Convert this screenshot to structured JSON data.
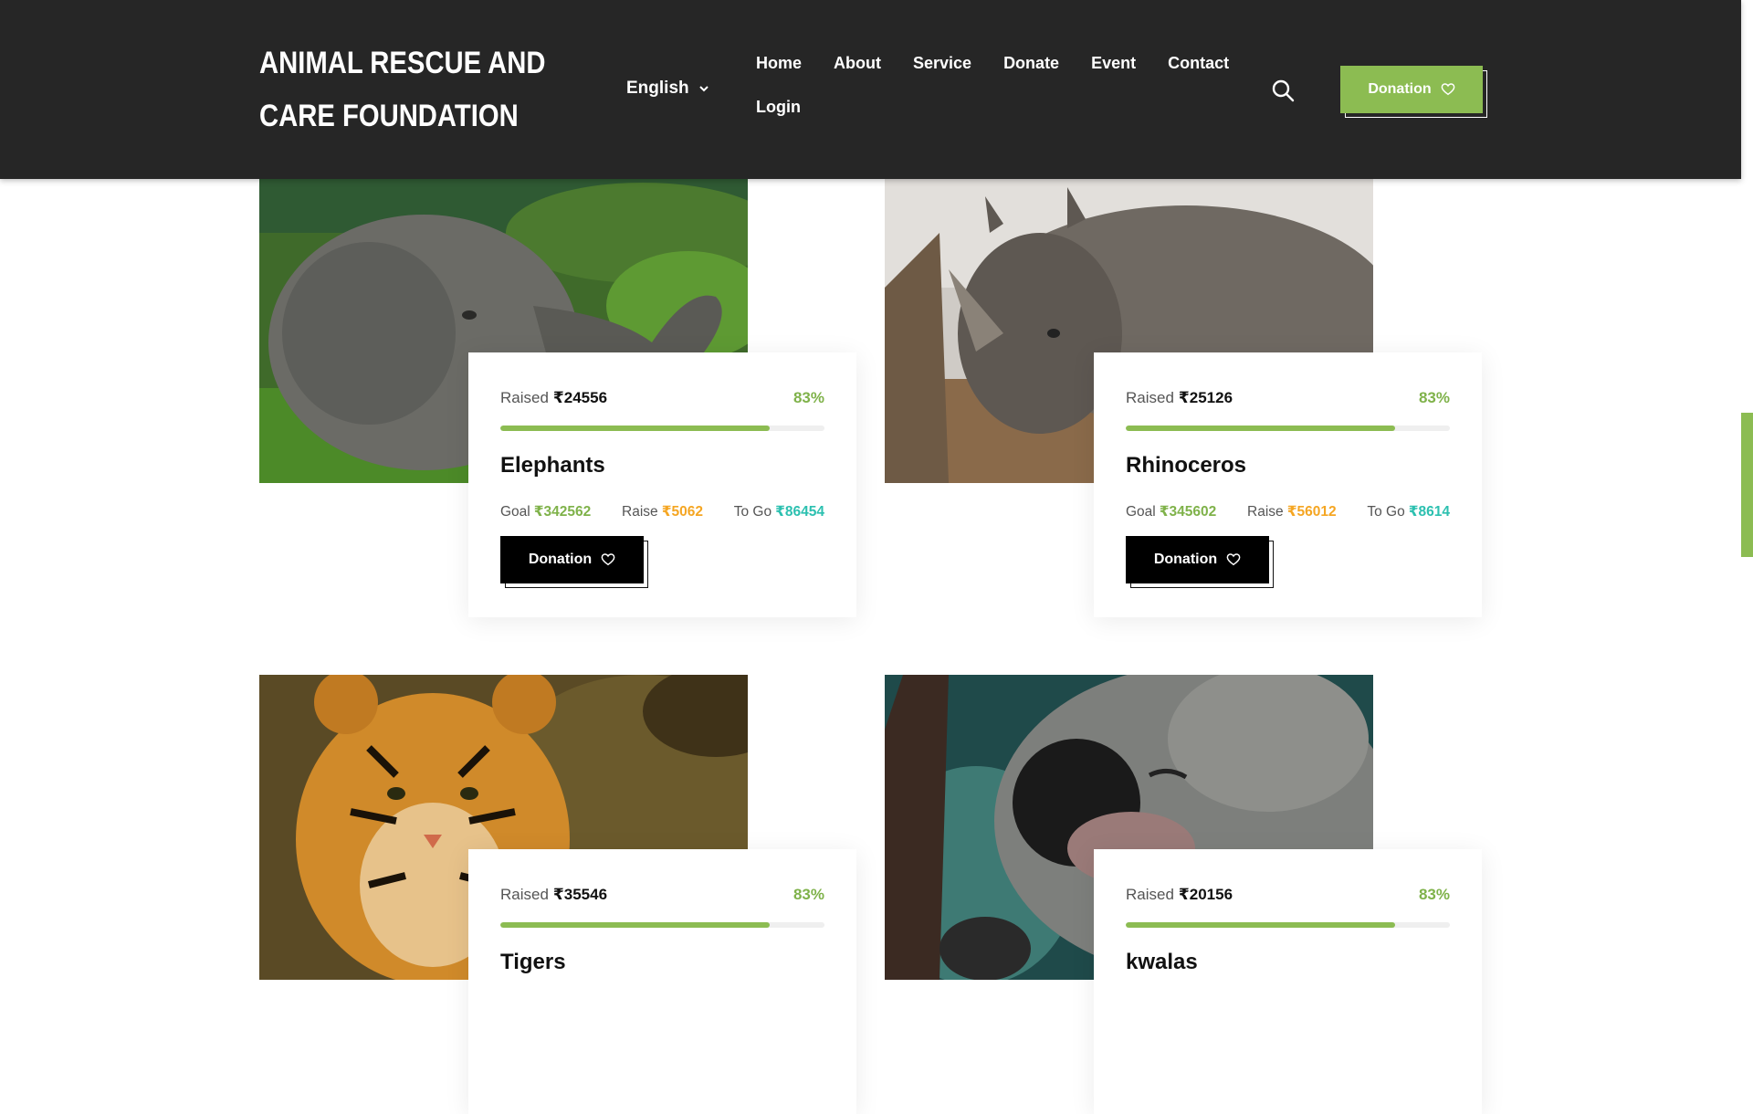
{
  "header": {
    "brand": "ANIMAL RESCUE AND CARE FOUNDATION",
    "language": "English",
    "nav": [
      "Home",
      "About",
      "Service",
      "Donate",
      "Event",
      "Contact",
      "Login"
    ],
    "donate_label": "Donation"
  },
  "colors": {
    "accent_green": "#8cbc52",
    "header_bg": "#262626",
    "raise_orange": "#f5a623",
    "togo_teal": "#2cc0b0"
  },
  "cards": [
    {
      "image_icon": "elephant-photo",
      "raised_label": "Raised",
      "raised": "₹24556",
      "percent": "83%",
      "progress": 0.83,
      "name": "Elephants",
      "goal_label": "Goal",
      "goal": "₹342562",
      "raise_label": "Raise",
      "raise": "₹5062",
      "togo_label": "To Go",
      "togo": "₹86454",
      "button": "Donation"
    },
    {
      "image_icon": "rhinoceros-photo",
      "raised_label": "Raised",
      "raised": "₹25126",
      "percent": "83%",
      "progress": 0.83,
      "name": "Rhinoceros",
      "goal_label": "Goal",
      "goal": "₹345602",
      "raise_label": "Raise",
      "raise": "₹56012",
      "togo_label": "To Go",
      "togo": "₹8614",
      "button": "Donation"
    },
    {
      "image_icon": "tiger-photo",
      "raised_label": "Raised",
      "raised": "₹35546",
      "percent": "83%",
      "progress": 0.83,
      "name": "Tigers"
    },
    {
      "image_icon": "koala-photo",
      "raised_label": "Raised",
      "raised": "₹20156",
      "percent": "83%",
      "progress": 0.83,
      "name": "kwalas"
    }
  ]
}
